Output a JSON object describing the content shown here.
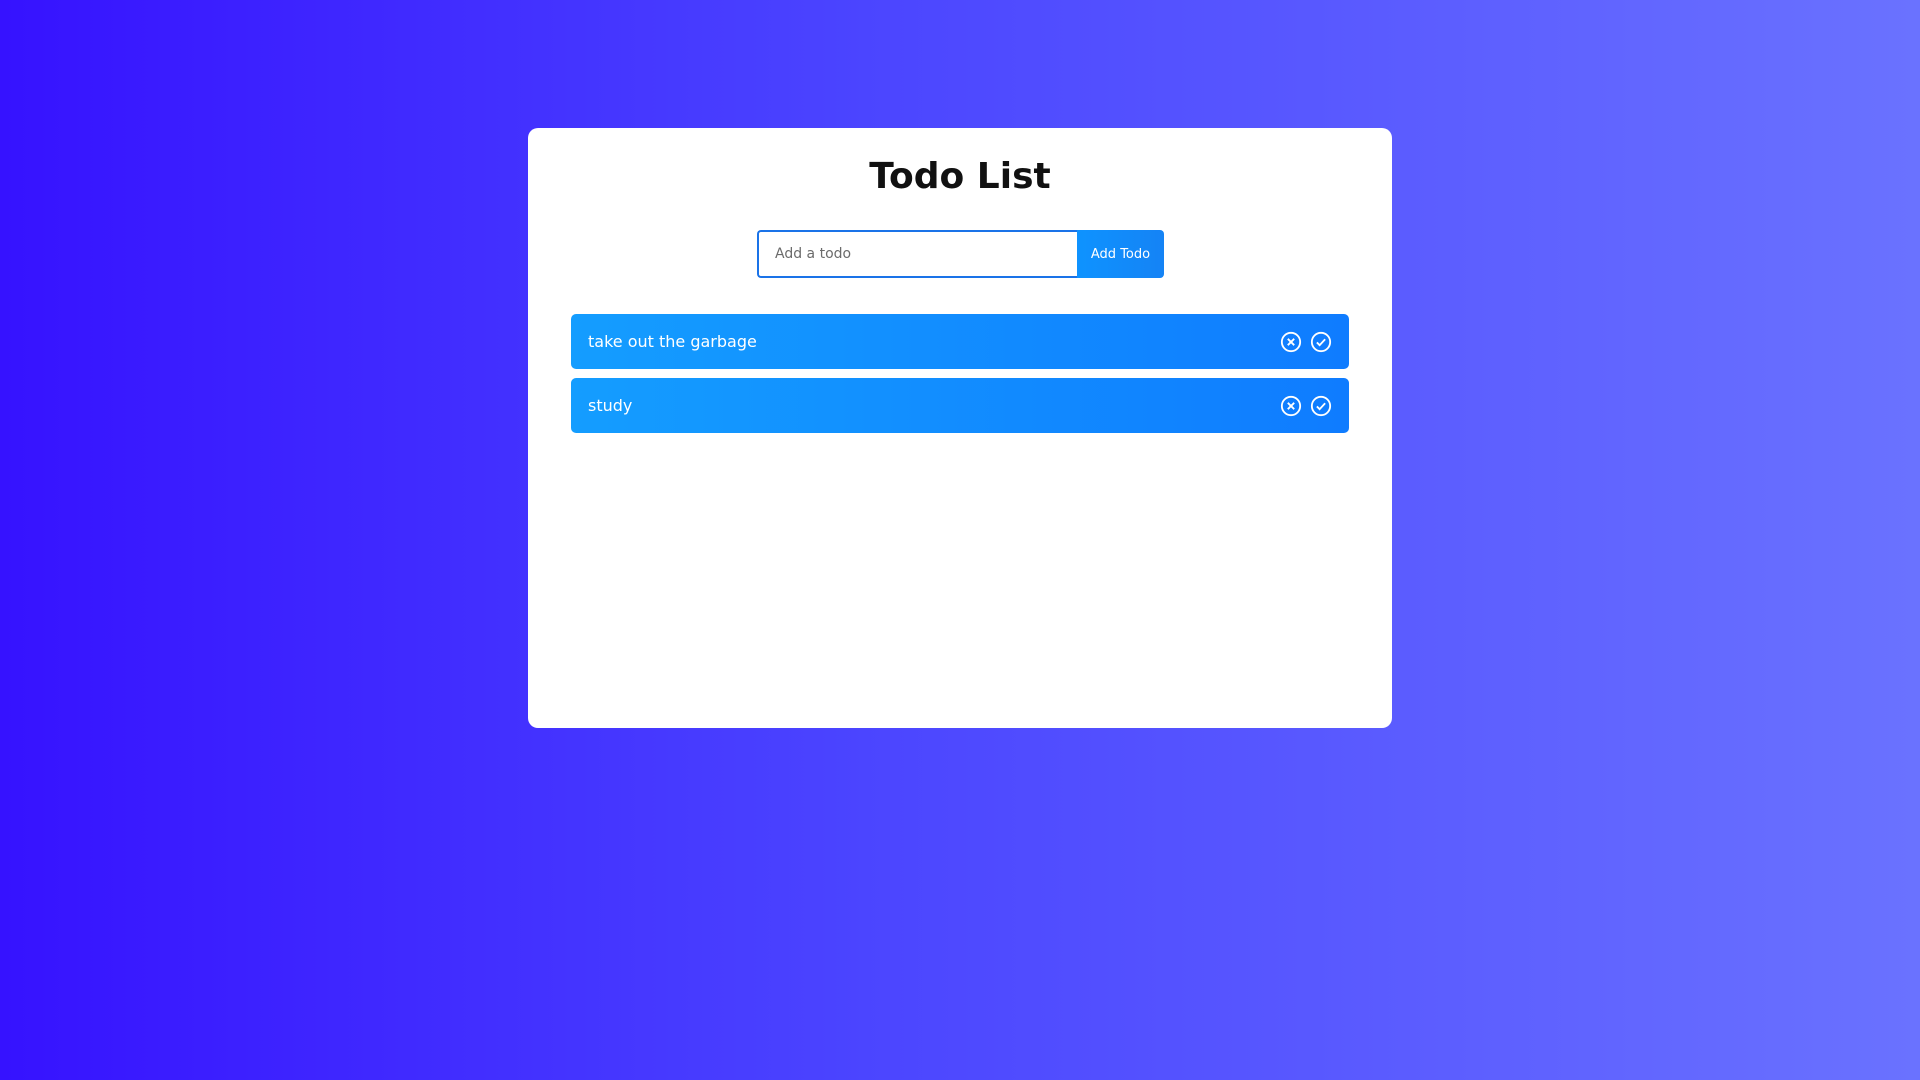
{
  "app": {
    "title": "Todo List"
  },
  "form": {
    "input_placeholder": "Add a todo",
    "input_value": "",
    "button_label": "Add Todo"
  },
  "todos": [
    {
      "text": "take out the garbage",
      "remove_icon": "close-circle-icon",
      "complete_icon": "check-circle-icon"
    },
    {
      "text": "study",
      "remove_icon": "close-circle-icon",
      "complete_icon": "check-circle-icon"
    }
  ],
  "colors": {
    "background_start": "#3612ff",
    "background_end": "#6a72ff",
    "card": "#ffffff",
    "accent": "#1583f5",
    "todo_row_start": "#149dff",
    "todo_row_end": "#0f7cff",
    "text_on_accent": "#ffffff"
  }
}
